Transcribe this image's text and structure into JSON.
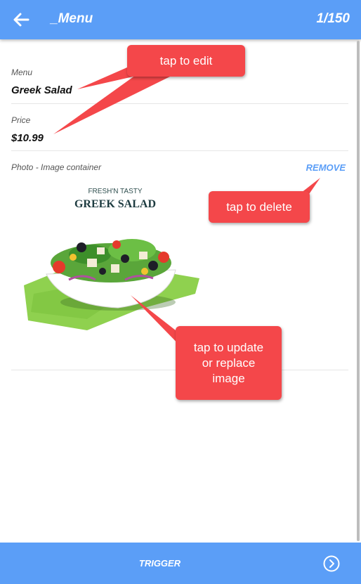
{
  "header": {
    "title": "_Menu",
    "counter": "1/150",
    "back_icon": "arrow-left-icon"
  },
  "fields": {
    "menu": {
      "label": "Menu",
      "value": "Greek Salad"
    },
    "price": {
      "label": "Price",
      "value": "$10.99"
    },
    "photo": {
      "label": "Photo - Image container",
      "remove_label": "REMOVE",
      "image_brand": "FRESH'N TASTY",
      "image_title": "GREEK SALAD"
    }
  },
  "callouts": {
    "edit": "tap to edit",
    "delete": "tap to delete",
    "update_line1": "tap to update",
    "update_line2": "or replace",
    "update_line3": "image"
  },
  "footer": {
    "trigger_label": "TRIGGER",
    "next_icon": "chevron-right-circle-icon"
  },
  "colors": {
    "primary": "#5b9ef7",
    "callout": "#f4474a",
    "napkin": "#8fd14f"
  }
}
